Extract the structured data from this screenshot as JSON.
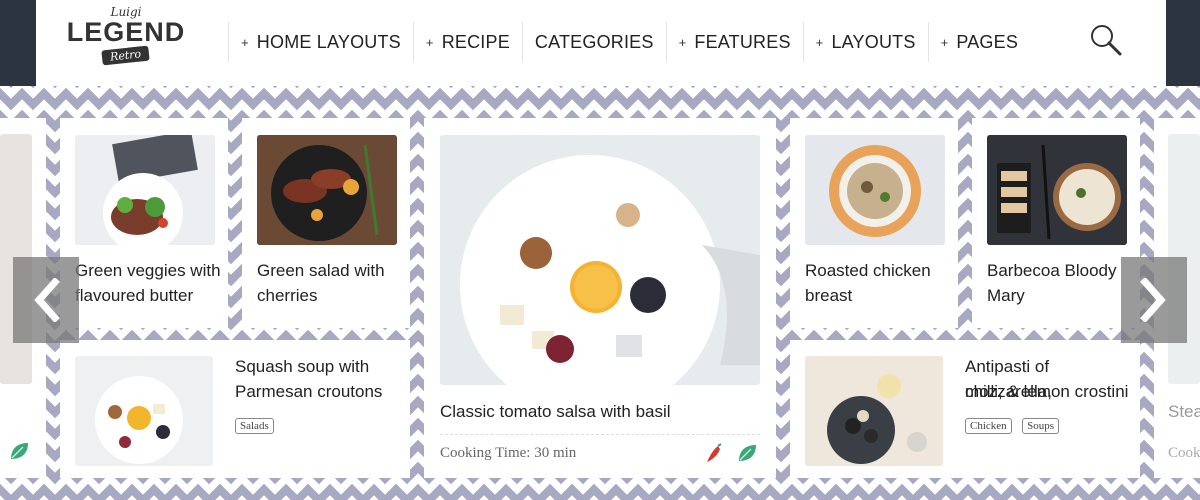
{
  "logo": {
    "top": "Luigi",
    "main": "LEGEND",
    "sub": "Retro"
  },
  "nav": [
    {
      "label": "HOME LAYOUTS",
      "plus": "+"
    },
    {
      "label": "RECIPE",
      "plus": "+"
    },
    {
      "label": "CATEGORIES",
      "plus": ""
    },
    {
      "label": "FEATURES",
      "plus": "+"
    },
    {
      "label": "LAYOUTS",
      "plus": "+"
    },
    {
      "label": "PAGES",
      "plus": "+"
    }
  ],
  "cards": {
    "green_veggies": {
      "title_line1": "Green veggies with",
      "title_line2": "flavoured butter"
    },
    "green_salad": {
      "title_line1": "Green salad with",
      "title_line2": "cherries"
    },
    "squash_soup": {
      "title_line1": "Squash soup with",
      "title_line2": "Parmesan croutons",
      "tags": [
        "Salads"
      ]
    },
    "featured": {
      "title": "Classic tomato salsa with basil",
      "cooking_label": "Cooking Time: 30 min"
    },
    "roasted_chicken": {
      "title_line1": "Roasted chicken",
      "title_line2": "breast"
    },
    "barbecoa": {
      "title_line1": "Barbecoa Bloody",
      "title_line2": "Mary"
    },
    "antipasti": {
      "title_line1": "Antipasti of mozzarella,",
      "title_line2": "chilli, & lemon crostini",
      "tags": [
        "Chicken",
        "Soups"
      ]
    },
    "right_partial": {
      "title": "Stea",
      "cooking": "Cook"
    }
  },
  "icons": {
    "search": "search-icon",
    "prev": "chevron-left-icon",
    "next": "chevron-right-icon",
    "leaf": "leaf-icon",
    "chili": "chili-icon"
  },
  "colors": {
    "pattern": "#a7a9c2",
    "leaf": "#3aa67a",
    "chili": "#d33a2c"
  }
}
